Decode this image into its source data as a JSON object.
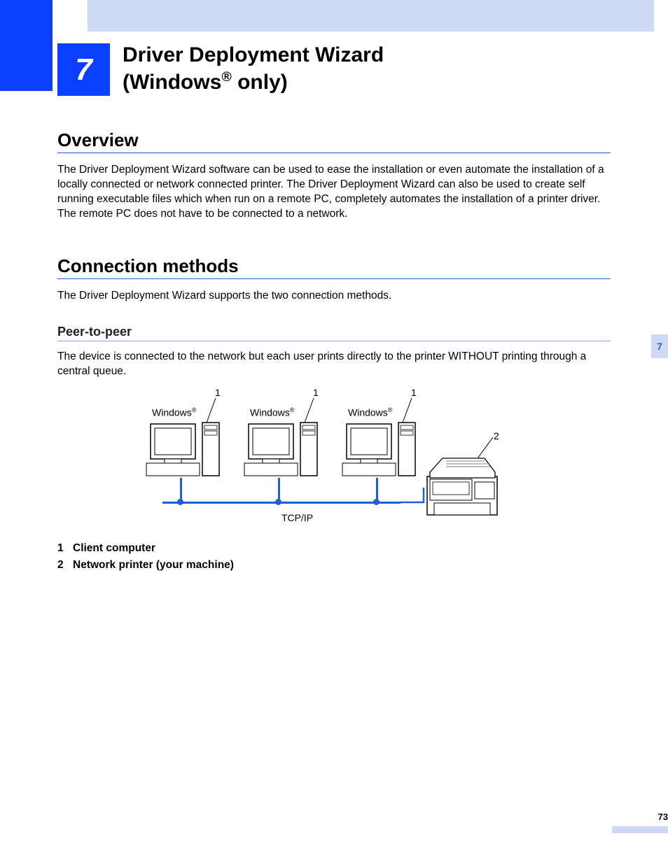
{
  "chapter": {
    "number": "7",
    "title_line1": "Driver Deployment Wizard",
    "title_line2_prefix": "(Windows",
    "title_line2_suffix": " only)"
  },
  "sections": {
    "overview": {
      "heading": "Overview",
      "body": "The Driver Deployment Wizard software can be used to ease the installation or even automate the installation of a locally connected or network connected printer. The Driver Deployment Wizard can also be used to create self running executable files which when run on a remote PC, completely automates the installation of a printer driver. The remote PC does not have to be connected to a network."
    },
    "connection": {
      "heading": "Connection methods",
      "intro": "The Driver Deployment Wizard supports the two connection methods."
    },
    "peer": {
      "heading": "Peer-to-peer",
      "body": "The device is connected to the network but each user prints directly to the printer WITHOUT printing through a central queue."
    }
  },
  "diagram": {
    "pc_os_label": "Windows",
    "protocol": "TCP/IP",
    "callout1": "1",
    "callout2": "2"
  },
  "legend": {
    "item1_num": "1",
    "item1_text": "Client computer",
    "item2_num": "2",
    "item2_text": "Network printer (your machine)"
  },
  "page": {
    "side_tab": "7",
    "number": "73"
  }
}
